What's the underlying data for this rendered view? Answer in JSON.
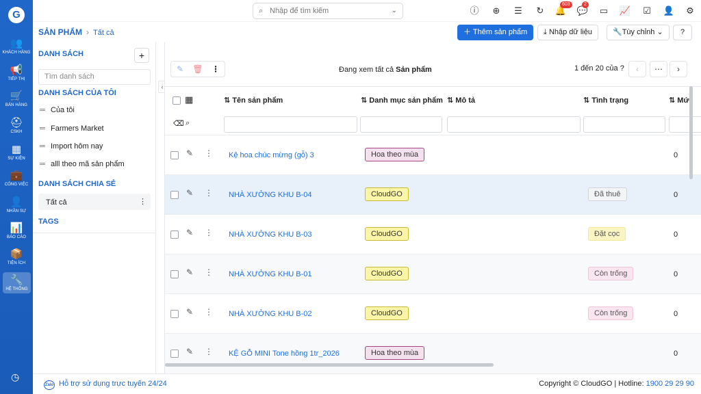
{
  "rail": {
    "logo": "G",
    "items": [
      {
        "label": "KHÁCH HÀNG",
        "icon": "users-icon",
        "glyph": "👥"
      },
      {
        "label": "TIẾP THỊ",
        "icon": "megaphone-icon",
        "glyph": "📢"
      },
      {
        "label": "BÁN HÀNG",
        "icon": "cart-icon",
        "glyph": "🛒"
      },
      {
        "label": "CSKH",
        "icon": "lifebuoy-icon",
        "glyph": "⛑"
      },
      {
        "label": "SỰ KIỆN",
        "icon": "calendar-icon",
        "glyph": "▦"
      },
      {
        "label": "CÔNG VIỆC",
        "icon": "briefcase-icon",
        "glyph": "💼"
      },
      {
        "label": "NHÂN SỰ",
        "icon": "person-icon",
        "glyph": "👤"
      },
      {
        "label": "BÁO CÁO",
        "icon": "report-icon",
        "glyph": "📊"
      },
      {
        "label": "TIỆN ÍCH",
        "icon": "box-icon",
        "glyph": "📦"
      },
      {
        "label": "HỆ THỐNG",
        "icon": "wrench-icon",
        "glyph": "🔧"
      }
    ],
    "clock_icon": "clock-icon"
  },
  "topbar": {
    "search_placeholder": "Nhập để tìm kiếm",
    "notifications_count": "603",
    "messages_count": "2"
  },
  "header": {
    "module": "SẢN PHẨM",
    "current": "Tất cả",
    "add_label": "Thêm sản phẩm",
    "import_label": "Nhập dữ liệu",
    "customize_label": "Tùy chỉnh"
  },
  "sidebar": {
    "lists_title": "DANH SÁCH",
    "search_placeholder": "Tìm danh sách",
    "my_lists_title": "DANH SÁCH CỦA TÔI",
    "my_lists": [
      "Của tôi",
      "Farmers Market",
      "Import hôm nay",
      "alll theo mã sản phẩm"
    ],
    "shared_title": "DANH SÁCH CHIA SẺ",
    "shared": [
      "Tất cả"
    ],
    "tags_title": "TAGS"
  },
  "table": {
    "viewing_prefix": "Đang xem tất cả",
    "viewing_entity": "Sản phẩm",
    "paging": "1 đến 20 của",
    "paging_help": "?",
    "columns": [
      "Tên sản phẩm",
      "Danh mục sản phẩm",
      "Mô tả",
      "Tình trạng",
      "Mức"
    ],
    "rows": [
      {
        "name": "Kệ hoa chúc mừng (gỗ) 3",
        "category": "Hoa theo mùa",
        "cat_style": "season",
        "status": "",
        "status_style": "",
        "level": "0"
      },
      {
        "name": "NHÀ XƯỞNG KHU B-04",
        "category": "CloudGO",
        "cat_style": "cloud",
        "status": "Đã thuê",
        "status_style": "rent",
        "level": "0"
      },
      {
        "name": "NHÀ XƯỞNG KHU B-03",
        "category": "CloudGO",
        "cat_style": "cloud",
        "status": "Đặt cọc",
        "status_style": "dep",
        "level": "0"
      },
      {
        "name": "NHÀ XƯỞNG KHU B-01",
        "category": "CloudGO",
        "cat_style": "cloud",
        "status": "Còn trống",
        "status_style": "free",
        "level": "0"
      },
      {
        "name": "NHÀ XƯỞNG KHU B-02",
        "category": "CloudGO",
        "cat_style": "cloud",
        "status": "Còn trống",
        "status_style": "free",
        "level": "0"
      },
      {
        "name": "KỆ GỖ MINI Tone hồng 1tr_2026",
        "category": "Hoa theo mùa",
        "cat_style": "season",
        "status": "",
        "status_style": "",
        "level": "0"
      }
    ]
  },
  "footer": {
    "help": "Hỗ trợ sử dụng trực tuyến 24/24",
    "zlogo": "Zalo",
    "copyright": "Copyright © CloudGO",
    "hotline_label": "Hotline:",
    "hotline": "1900 29 29 90"
  },
  "colors": {
    "brand": "#1f67c9",
    "primary_button": "#1f6fde"
  }
}
